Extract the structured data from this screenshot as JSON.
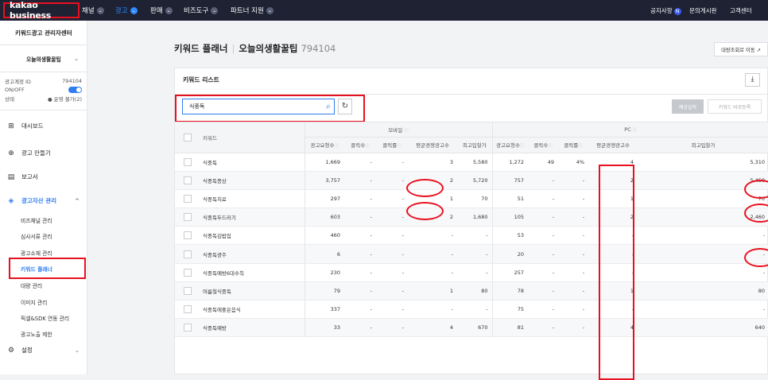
{
  "topbar": {
    "logo": "kakao business",
    "nav": [
      {
        "label": "채널",
        "active": false
      },
      {
        "label": "광고",
        "active": true
      },
      {
        "label": "판매",
        "active": false
      },
      {
        "label": "비즈도구",
        "active": false
      },
      {
        "label": "파트너 지원",
        "active": false
      }
    ],
    "notice": "공지사항",
    "notice_badge": "N",
    "inquiry": "문의게시판",
    "support": "고객센터"
  },
  "sidebar": {
    "title": "키워드광고 관리자센터",
    "account_name": "오늘의생활꿀팁",
    "account_id_label": "광고계정 ID",
    "account_id": "794104",
    "onoff_label": "ON/OFF",
    "status_label": "상태",
    "status_value": "운영 불가(2)",
    "menus": {
      "dashboard": "대시보드",
      "create_ad": "광고 만들기",
      "report": "보고서",
      "asset": "광고자산 관리",
      "settings": "설정"
    },
    "sub_items": [
      "비즈채널 관리",
      "심사서류 관리",
      "광고소재 관리",
      "키워드 플래너",
      "대량 관리",
      "이미지 관리",
      "픽셀&SDK 연동 관리",
      "광고노출 제한"
    ]
  },
  "main": {
    "title": "키워드 플래너",
    "account": "오늘의생활꿀팁",
    "account_id": "794104",
    "bulk_link": "대량조회로 이동 ↗",
    "panel_title": "키워드 리스트",
    "search_value": "식중독",
    "predict_button": "예상실적",
    "direct_register_button": "키워드 바로등록",
    "mobile_group": "모바일",
    "pc_group": "PC",
    "columns": {
      "keyword": "키워드",
      "requests": "광고요청수",
      "clicks": "클릭수",
      "ctr": "클릭률",
      "avg_comp": "평균경쟁광고수",
      "max_bid": "최고입찰가"
    },
    "rows": [
      {
        "kw": "식중독",
        "m": [
          "1,669",
          "-",
          "-",
          "3",
          "5,580"
        ],
        "p": [
          "1,272",
          "49",
          "4%",
          "4",
          "5,310"
        ]
      },
      {
        "kw": "식중독증상",
        "m": [
          "3,757",
          "-",
          "-",
          "2",
          "5,720"
        ],
        "p": [
          "757",
          "-",
          "-",
          "2",
          "5,450"
        ]
      },
      {
        "kw": "식중독치료",
        "m": [
          "297",
          "-",
          "-",
          "1",
          "70"
        ],
        "p": [
          "51",
          "-",
          "-",
          "1",
          "70"
        ]
      },
      {
        "kw": "식중독두드러기",
        "m": [
          "603",
          "-",
          "-",
          "2",
          "1,680"
        ],
        "p": [
          "105",
          "-",
          "-",
          "2",
          "2,460"
        ]
      },
      {
        "kw": "식중독김밥집",
        "m": [
          "460",
          "-",
          "-",
          "-",
          "-"
        ],
        "p": [
          "53",
          "-",
          "-",
          "-",
          "-"
        ]
      },
      {
        "kw": "식중독광주",
        "m": [
          "6",
          "-",
          "-",
          "-",
          "-"
        ],
        "p": [
          "20",
          "-",
          "-",
          "-",
          "-"
        ]
      },
      {
        "kw": "식중독예방6대수칙",
        "m": [
          "230",
          "-",
          "-",
          "-",
          "-"
        ],
        "p": [
          "257",
          "-",
          "-",
          "-",
          "-"
        ]
      },
      {
        "kw": "여름철식중독",
        "m": [
          "79",
          "-",
          "-",
          "1",
          "80"
        ],
        "p": [
          "78",
          "-",
          "-",
          "1",
          "80"
        ]
      },
      {
        "kw": "식중독에좋은음식",
        "m": [
          "337",
          "-",
          "-",
          "-",
          "-"
        ],
        "p": [
          "75",
          "-",
          "-",
          "-",
          "-"
        ]
      },
      {
        "kw": "식중독예방",
        "m": [
          "33",
          "-",
          "-",
          "4",
          "670"
        ],
        "p": [
          "81",
          "-",
          "-",
          "4",
          "640"
        ]
      }
    ]
  }
}
